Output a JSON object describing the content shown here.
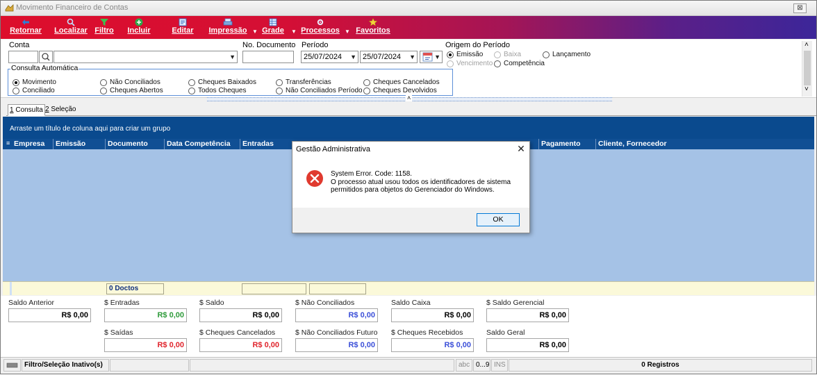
{
  "window": {
    "title": "Movimento Financeiro de Contas",
    "close_glyph": "⊠"
  },
  "toolbar": {
    "buttons": [
      {
        "label": "Retornar"
      },
      {
        "label": "Localizar"
      },
      {
        "label": "Filtro"
      },
      {
        "label": "Incluir"
      },
      {
        "label": "Editar"
      },
      {
        "label": "Impressão"
      },
      {
        "label": "Grade"
      },
      {
        "label": "Processos"
      },
      {
        "label": "Favoritos"
      }
    ]
  },
  "form": {
    "conta_label": "Conta",
    "conta_value": "",
    "documento_label": "No. Documento",
    "documento_value": "",
    "periodo_label": "Período",
    "periodo_inicio": "25/07/2024",
    "periodo_fim": "25/07/2024",
    "origem_label": "Origem do Período",
    "origem_options": [
      "Emissão",
      "Baixa",
      "Lançamento",
      "Vencimento",
      "Competência"
    ],
    "consulta_label": "Consulta Automática",
    "consulta_options": [
      "Movimento",
      "Conciliado",
      "Não Conciliados",
      "Cheques Abertos",
      "Cheques Baixados",
      "Todos Cheques",
      "Transferências",
      "Não Conciliados Período",
      "Cheques Cancelados",
      "Cheques Devolvidos"
    ]
  },
  "tabs": [
    {
      "key": "1",
      "label": " Consulta"
    },
    {
      "key": "2",
      "label": " Seleção"
    }
  ],
  "grid": {
    "group_hint": "Arraste um título de coluna aqui para criar um grupo",
    "columns": [
      "Empresa",
      "Emissão",
      "Documento",
      "Data Competência",
      "Entradas",
      "Pagamento",
      "Cliente, Fornecedor"
    ],
    "footer_count": "0 Doctos"
  },
  "totals": {
    "saldo_anterior": {
      "label": "Saldo Anterior",
      "value": "R$ 0,00"
    },
    "entradas": {
      "label": "$ Entradas",
      "value": "R$ 0,00"
    },
    "saldo": {
      "label": "$ Saldo",
      "value": "R$ 0,00"
    },
    "nao_conciliados": {
      "label": "$ Não Conciliados",
      "value": "R$ 0,00"
    },
    "saldo_caixa": {
      "label": "Saldo Caixa",
      "value": "R$ 0,00"
    },
    "saldo_gerencial": {
      "label": "$ Saldo Gerencial",
      "value": "R$ 0,00"
    },
    "saidas": {
      "label": "$ Saídas",
      "value": "R$ 0,00"
    },
    "cheques_cancelados": {
      "label": "$ Cheques Cancelados",
      "value": "R$ 0,00"
    },
    "nao_conciliados_futuro": {
      "label": "$ Não Conciliados Futuro",
      "value": "R$ 0,00"
    },
    "cheques_recebidos": {
      "label": "$ Cheques Recebidos",
      "value": "R$ 0,00"
    },
    "saldo_geral": {
      "label": "Saldo Geral",
      "value": "R$ 0,00"
    }
  },
  "statusbar": {
    "filter_status": "Filtro/Seleção Inativo(s)",
    "abc": "abc",
    "digits": "0...9",
    "ins": "INS",
    "records": "0 Registros"
  },
  "dialog": {
    "title": "Gestão Administrativa",
    "line1": "System Error.  Code: 1158.",
    "line2": "O processo atual usou todos os identificadores de sistema",
    "line3": "permitidos para objetos do Gerenciador do Windows.",
    "ok_label": "OK",
    "close_glyph": "✕"
  },
  "colors": {
    "toolbar_start": "#dd0e2c",
    "toolbar_end": "#3c2699",
    "grid_header": "#104f94",
    "grid_body": "#a5c2e6",
    "value_entradas": "#2e9b3a",
    "value_negative": "#e0242c",
    "value_blue": "#3b4fd8",
    "error_red": "#e03a2f"
  }
}
